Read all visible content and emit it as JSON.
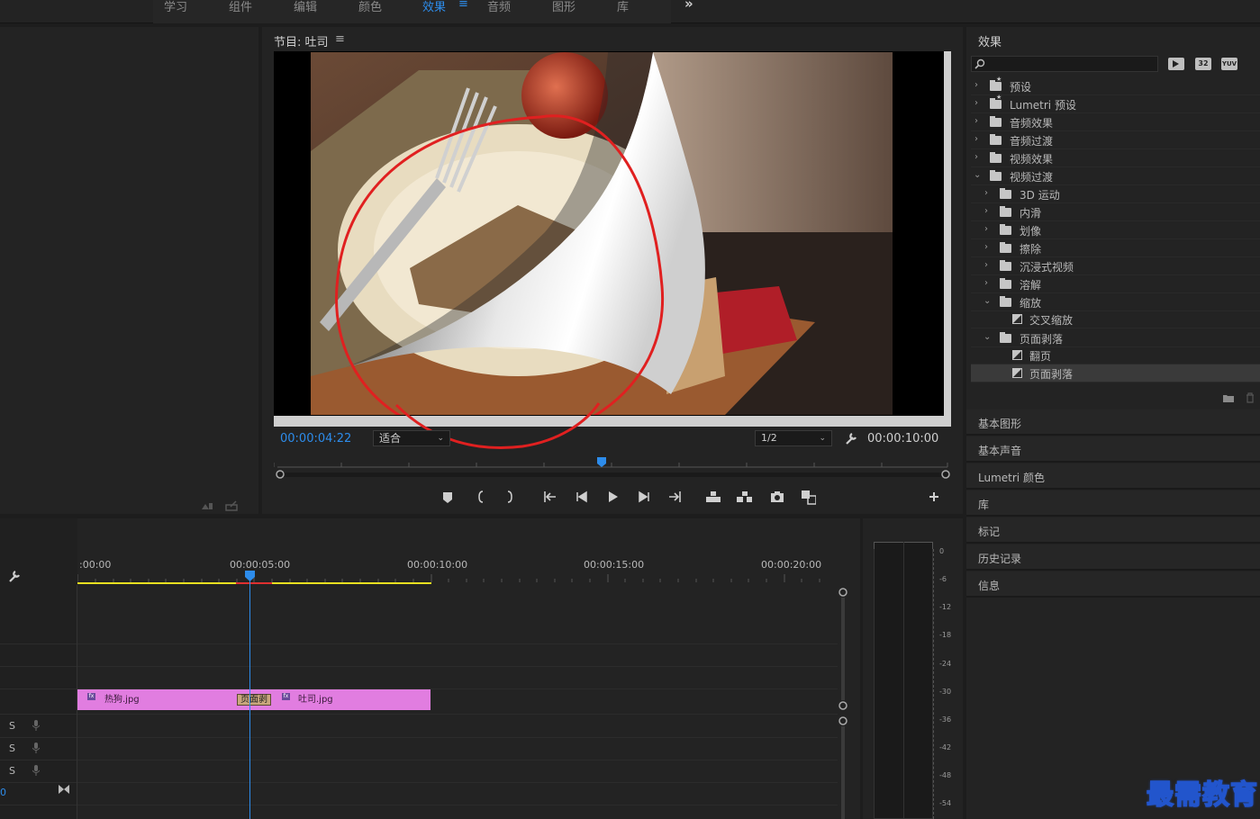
{
  "workspace": {
    "tabs": [
      {
        "label": "学习"
      },
      {
        "label": "组件"
      },
      {
        "label": "编辑"
      },
      {
        "label": "颜色"
      },
      {
        "label": "效果"
      },
      {
        "label": "音频"
      },
      {
        "label": "图形"
      },
      {
        "label": "库"
      }
    ],
    "active_tab": "效果",
    "more_label": "»"
  },
  "program_monitor": {
    "title": "节目: 吐司",
    "timecode": "00:00:04:22",
    "zoom": "适合",
    "resolution": "1/2",
    "duration": "00:00:10:00"
  },
  "effects_panel": {
    "title": "效果",
    "search_placeholder": "",
    "badges": [
      "32",
      "YUV"
    ],
    "tree": [
      {
        "label": "预设",
        "level": 0,
        "type": "preset",
        "expanded": false
      },
      {
        "label": "Lumetri 预设",
        "level": 0,
        "type": "preset",
        "expanded": false
      },
      {
        "label": "音频效果",
        "level": 0,
        "type": "folder",
        "expanded": false
      },
      {
        "label": "音频过渡",
        "level": 0,
        "type": "folder",
        "expanded": false
      },
      {
        "label": "视频效果",
        "level": 0,
        "type": "folder",
        "expanded": false
      },
      {
        "label": "视频过渡",
        "level": 0,
        "type": "folder",
        "expanded": true
      },
      {
        "label": "3D 运动",
        "level": 1,
        "type": "folder",
        "expanded": false
      },
      {
        "label": "内滑",
        "level": 1,
        "type": "folder",
        "expanded": false
      },
      {
        "label": "划像",
        "level": 1,
        "type": "folder",
        "expanded": false
      },
      {
        "label": "擦除",
        "level": 1,
        "type": "folder",
        "expanded": false
      },
      {
        "label": "沉浸式视频",
        "level": 1,
        "type": "folder",
        "expanded": false
      },
      {
        "label": "溶解",
        "level": 1,
        "type": "folder",
        "expanded": false
      },
      {
        "label": "缩放",
        "level": 1,
        "type": "folder",
        "expanded": true
      },
      {
        "label": "交叉缩放",
        "level": 2,
        "type": "effect"
      },
      {
        "label": "页面剥落",
        "level": 1,
        "type": "folder",
        "expanded": true
      },
      {
        "label": "翻页",
        "level": 2,
        "type": "effect"
      },
      {
        "label": "页面剥落",
        "level": 2,
        "type": "effect",
        "selected": true
      }
    ]
  },
  "side_panels": [
    {
      "label": "基本图形"
    },
    {
      "label": "基本声音"
    },
    {
      "label": "Lumetri 颜色"
    },
    {
      "label": "库"
    },
    {
      "label": "标记"
    },
    {
      "label": "历史记录"
    },
    {
      "label": "信息"
    }
  ],
  "timeline": {
    "ruler": [
      ":00:00",
      "00:00:05:00",
      "00:00:10:00",
      "00:00:15:00",
      "00:00:20:00"
    ],
    "clips": [
      {
        "name": "热狗.jpg"
      },
      {
        "name": "吐司.jpg"
      }
    ],
    "transition_label": "页面剥",
    "audio_track_labels": [
      "S",
      "S",
      "S"
    ],
    "timecode_fragment": "0"
  },
  "audio_meter": {
    "scale": [
      "0",
      "-6",
      "-12",
      "-18",
      "-24",
      "-30",
      "-36",
      "-42",
      "-48",
      "-54"
    ]
  },
  "watermark": "最需教育",
  "colors": {
    "accent_blue": "#2d8ceb",
    "clip_pink": "#e17de0",
    "annotation_red": "#e02020",
    "work_area_yellow": "#e8e020"
  }
}
